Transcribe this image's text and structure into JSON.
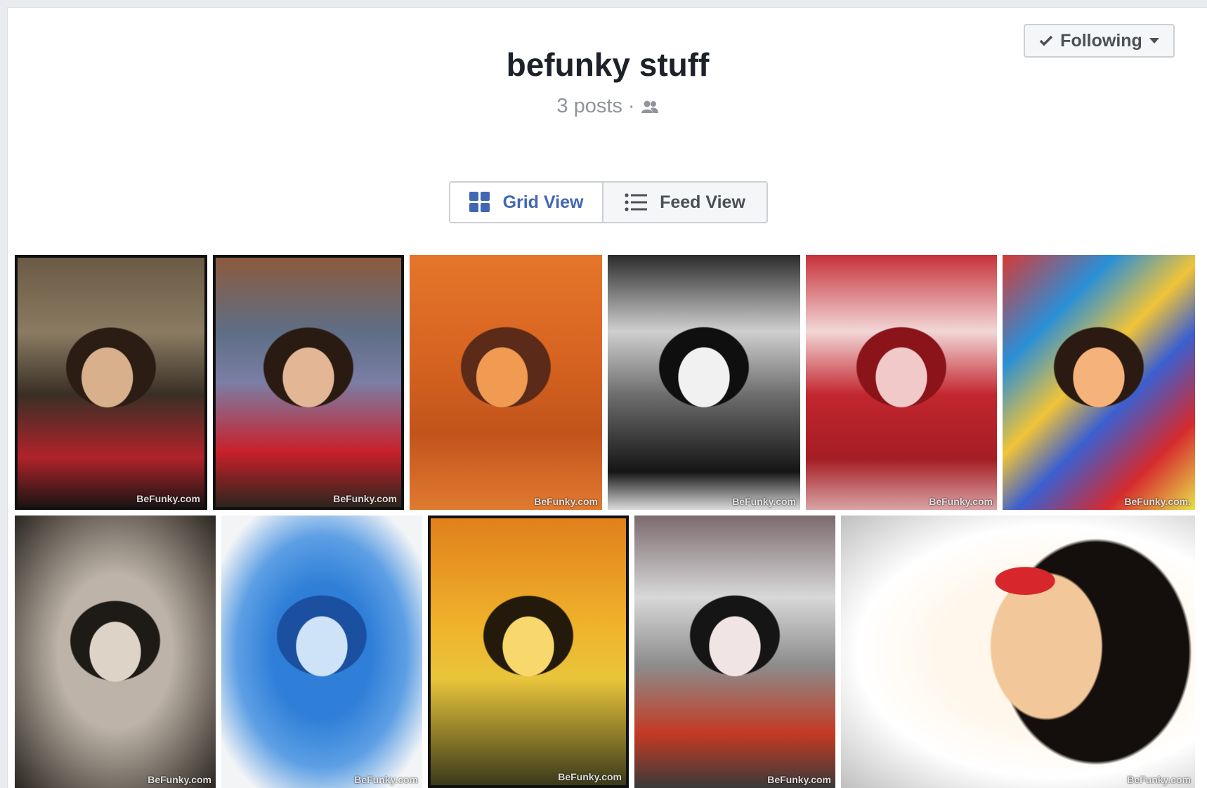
{
  "header": {
    "title": "befunky stuff",
    "posts": "3 posts",
    "separator": "·",
    "follow_label": "Following"
  },
  "view_toggle": {
    "grid_label": "Grid View",
    "feed_label": "Feed View"
  },
  "photos": [
    {
      "watermark": "BeFunky.com",
      "style": "cartoon-dark"
    },
    {
      "watermark": "BeFunky.com",
      "style": "cartoon-color"
    },
    {
      "watermark": "BeFunky.com",
      "style": "orange-sketch"
    },
    {
      "watermark": "BeFunky.com",
      "style": "black-white"
    },
    {
      "watermark": "BeFunky.com",
      "style": "red-tint"
    },
    {
      "watermark": "BeFunky.com.",
      "style": "pop-art"
    },
    {
      "watermark": "BeFunky.com",
      "style": "grunge-gray"
    },
    {
      "watermark": "BeFunky.com",
      "style": "blue-stencil"
    },
    {
      "watermark": "BeFunky.com",
      "style": "yellow-orange"
    },
    {
      "watermark": "BeFunky.com",
      "style": "dotted-color"
    },
    {
      "watermark": "BeFunky.com",
      "style": "comic-portrait"
    }
  ],
  "colors": {
    "accent": "#4267b2",
    "text": "#1d2129",
    "muted": "#90949c"
  }
}
